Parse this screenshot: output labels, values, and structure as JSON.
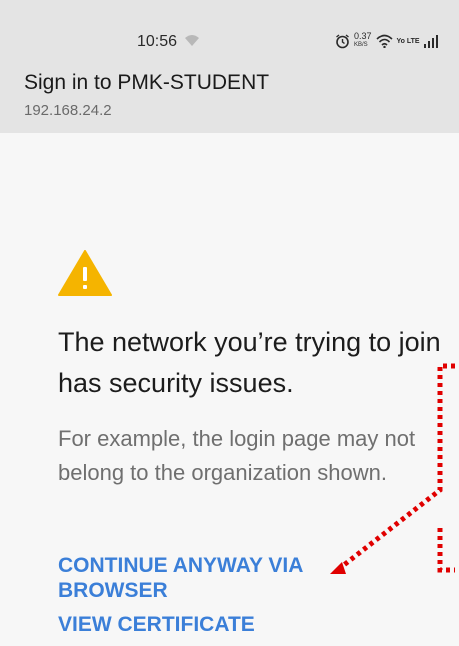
{
  "status_bar": {
    "time": "10:56",
    "speed_value": "0.37",
    "speed_unit": "KB/S",
    "network_type": "Yo LTE",
    "icons": [
      "wifi-small-icon",
      "alarm-icon",
      "wifi-icon",
      "signal-icon"
    ]
  },
  "header": {
    "title": "Sign in to PMK-STUDENT",
    "subtitle": "192.168.24.2"
  },
  "warning": {
    "icon": "warning-icon",
    "color": "#f5b400",
    "headline": "The network you’re trying to join has security issues.",
    "description": "For example, the login page may not belong to the organization shown."
  },
  "actions": {
    "continue_label": "CONTINUE ANYWAY VIA BROWSER",
    "certificate_label": "VIEW CERTIFICATE",
    "accent_color": "#3b7fd8"
  },
  "annotation": {
    "color": "#e00000",
    "style": "dotted arrow"
  }
}
